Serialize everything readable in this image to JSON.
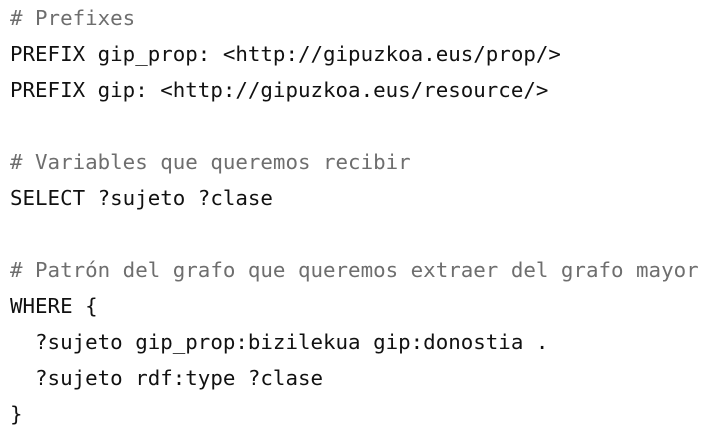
{
  "code": {
    "lines": [
      {
        "text": "# Prefixes",
        "kind": "comment"
      },
      {
        "text": "PREFIX gip_prop: <http://gipuzkoa.eus/prop/>",
        "kind": "code"
      },
      {
        "text": "PREFIX gip: <http://gipuzkoa.eus/resource/>",
        "kind": "code"
      },
      {
        "text": "",
        "kind": "blank"
      },
      {
        "text": "# Variables que queremos recibir",
        "kind": "comment"
      },
      {
        "text": "SELECT ?sujeto ?clase",
        "kind": "code"
      },
      {
        "text": "",
        "kind": "blank"
      },
      {
        "text": "# Patrón del grafo que queremos extraer del grafo mayor",
        "kind": "comment"
      },
      {
        "text": "WHERE {",
        "kind": "code"
      },
      {
        "text": "  ?sujeto gip_prop:bizilekua gip:donostia .",
        "kind": "code"
      },
      {
        "text": "  ?sujeto rdf:type ?clase",
        "kind": "code"
      },
      {
        "text": "}",
        "kind": "code"
      }
    ]
  },
  "colors": {
    "comment": "#6e6e6e",
    "code": "#111111",
    "background": "#ffffff"
  }
}
